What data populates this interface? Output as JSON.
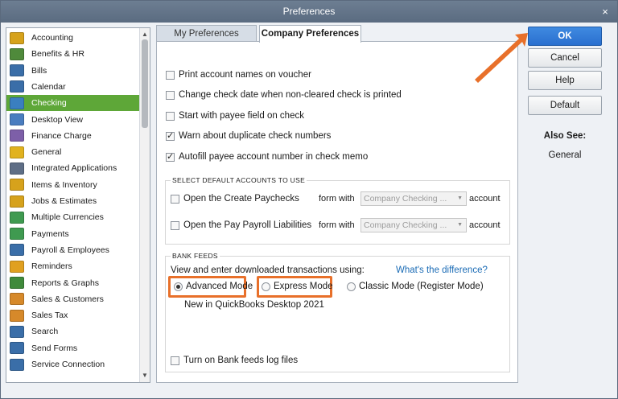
{
  "window": {
    "title": "Preferences",
    "close_glyph": "×"
  },
  "sidebar": {
    "items": [
      {
        "label": "Accounting",
        "icon": "accounting-icon",
        "color": "#d6a21c"
      },
      {
        "label": "Benefits & HR",
        "icon": "benefits-icon",
        "color": "#4f8a3b"
      },
      {
        "label": "Bills",
        "icon": "bills-icon",
        "color": "#3a6ea8"
      },
      {
        "label": "Calendar",
        "icon": "calendar-icon",
        "color": "#3a6ea8"
      },
      {
        "label": "Checking",
        "icon": "checking-icon",
        "color": "#3a7fc0",
        "selected": true
      },
      {
        "label": "Desktop View",
        "icon": "desktop-view-icon",
        "color": "#4a7dbf"
      },
      {
        "label": "Finance Charge",
        "icon": "finance-charge-icon",
        "color": "#7d5fa8"
      },
      {
        "label": "General",
        "icon": "general-icon",
        "color": "#e1b21e"
      },
      {
        "label": "Integrated Applications",
        "icon": "integrated-apps-icon",
        "color": "#5e6e86"
      },
      {
        "label": "Items & Inventory",
        "icon": "items-inventory-icon",
        "color": "#d6a21c"
      },
      {
        "label": "Jobs & Estimates",
        "icon": "jobs-estimates-icon",
        "color": "#d6a21c"
      },
      {
        "label": "Multiple Currencies",
        "icon": "multiple-currencies-icon",
        "color": "#3f9a50"
      },
      {
        "label": "Payments",
        "icon": "payments-icon",
        "color": "#3f9a50"
      },
      {
        "label": "Payroll & Employees",
        "icon": "payroll-icon",
        "color": "#3a6ea8"
      },
      {
        "label": "Reminders",
        "icon": "reminders-icon",
        "color": "#e0a020"
      },
      {
        "label": "Reports & Graphs",
        "icon": "reports-graphs-icon",
        "color": "#3f8a3b"
      },
      {
        "label": "Sales & Customers",
        "icon": "sales-customers-icon",
        "color": "#d6892a"
      },
      {
        "label": "Sales Tax",
        "icon": "sales-tax-icon",
        "color": "#d6892a"
      },
      {
        "label": "Search",
        "icon": "search-icon",
        "color": "#3a6ea8"
      },
      {
        "label": "Send Forms",
        "icon": "send-forms-icon",
        "color": "#3a6ea8"
      },
      {
        "label": "Service Connection",
        "icon": "service-connection-icon",
        "color": "#3a6ea8"
      }
    ],
    "scroll_up": "▲",
    "scroll_down": "▼"
  },
  "tabs": {
    "my": "My Preferences",
    "company": "Company Preferences"
  },
  "checkboxes": [
    {
      "label": "Print account names on voucher",
      "checked": false
    },
    {
      "label": "Change check date when non-cleared check is printed",
      "checked": false
    },
    {
      "label": "Start with payee field on check",
      "checked": false
    },
    {
      "label": "Warn about duplicate check numbers",
      "checked": true
    },
    {
      "label": "Autofill payee account number in check memo",
      "checked": true
    }
  ],
  "default_accounts": {
    "title": "SELECT DEFAULT ACCOUNTS TO USE",
    "rows": [
      {
        "label": "Open the Create Paychecks",
        "form_with": "form with",
        "select": "Company Checking ...",
        "account": "account"
      },
      {
        "label": "Open the Pay Payroll Liabilities",
        "form_with": "form with",
        "select": "Company Checking ...",
        "account": "account"
      }
    ]
  },
  "bank_feeds": {
    "title": "BANK FEEDS",
    "prompt": "View and enter downloaded transactions using:",
    "link": "What's the difference?",
    "modes": [
      {
        "label": "Advanced Mode",
        "selected": true
      },
      {
        "label": "Express Mode",
        "selected": false
      },
      {
        "label": "Classic Mode (Register Mode)",
        "selected": false
      }
    ],
    "note": "New in QuickBooks Desktop 2021",
    "log_label": "Turn on Bank feeds log files"
  },
  "buttons": {
    "ok": "OK",
    "cancel": "Cancel",
    "help": "Help",
    "default": "Default"
  },
  "also_see": {
    "heading": "Also See:",
    "link": "General"
  },
  "colors": {
    "selected_bg": "#5ea738",
    "highlight": "#e8702a",
    "ok_blue": "#2a6fcf"
  }
}
